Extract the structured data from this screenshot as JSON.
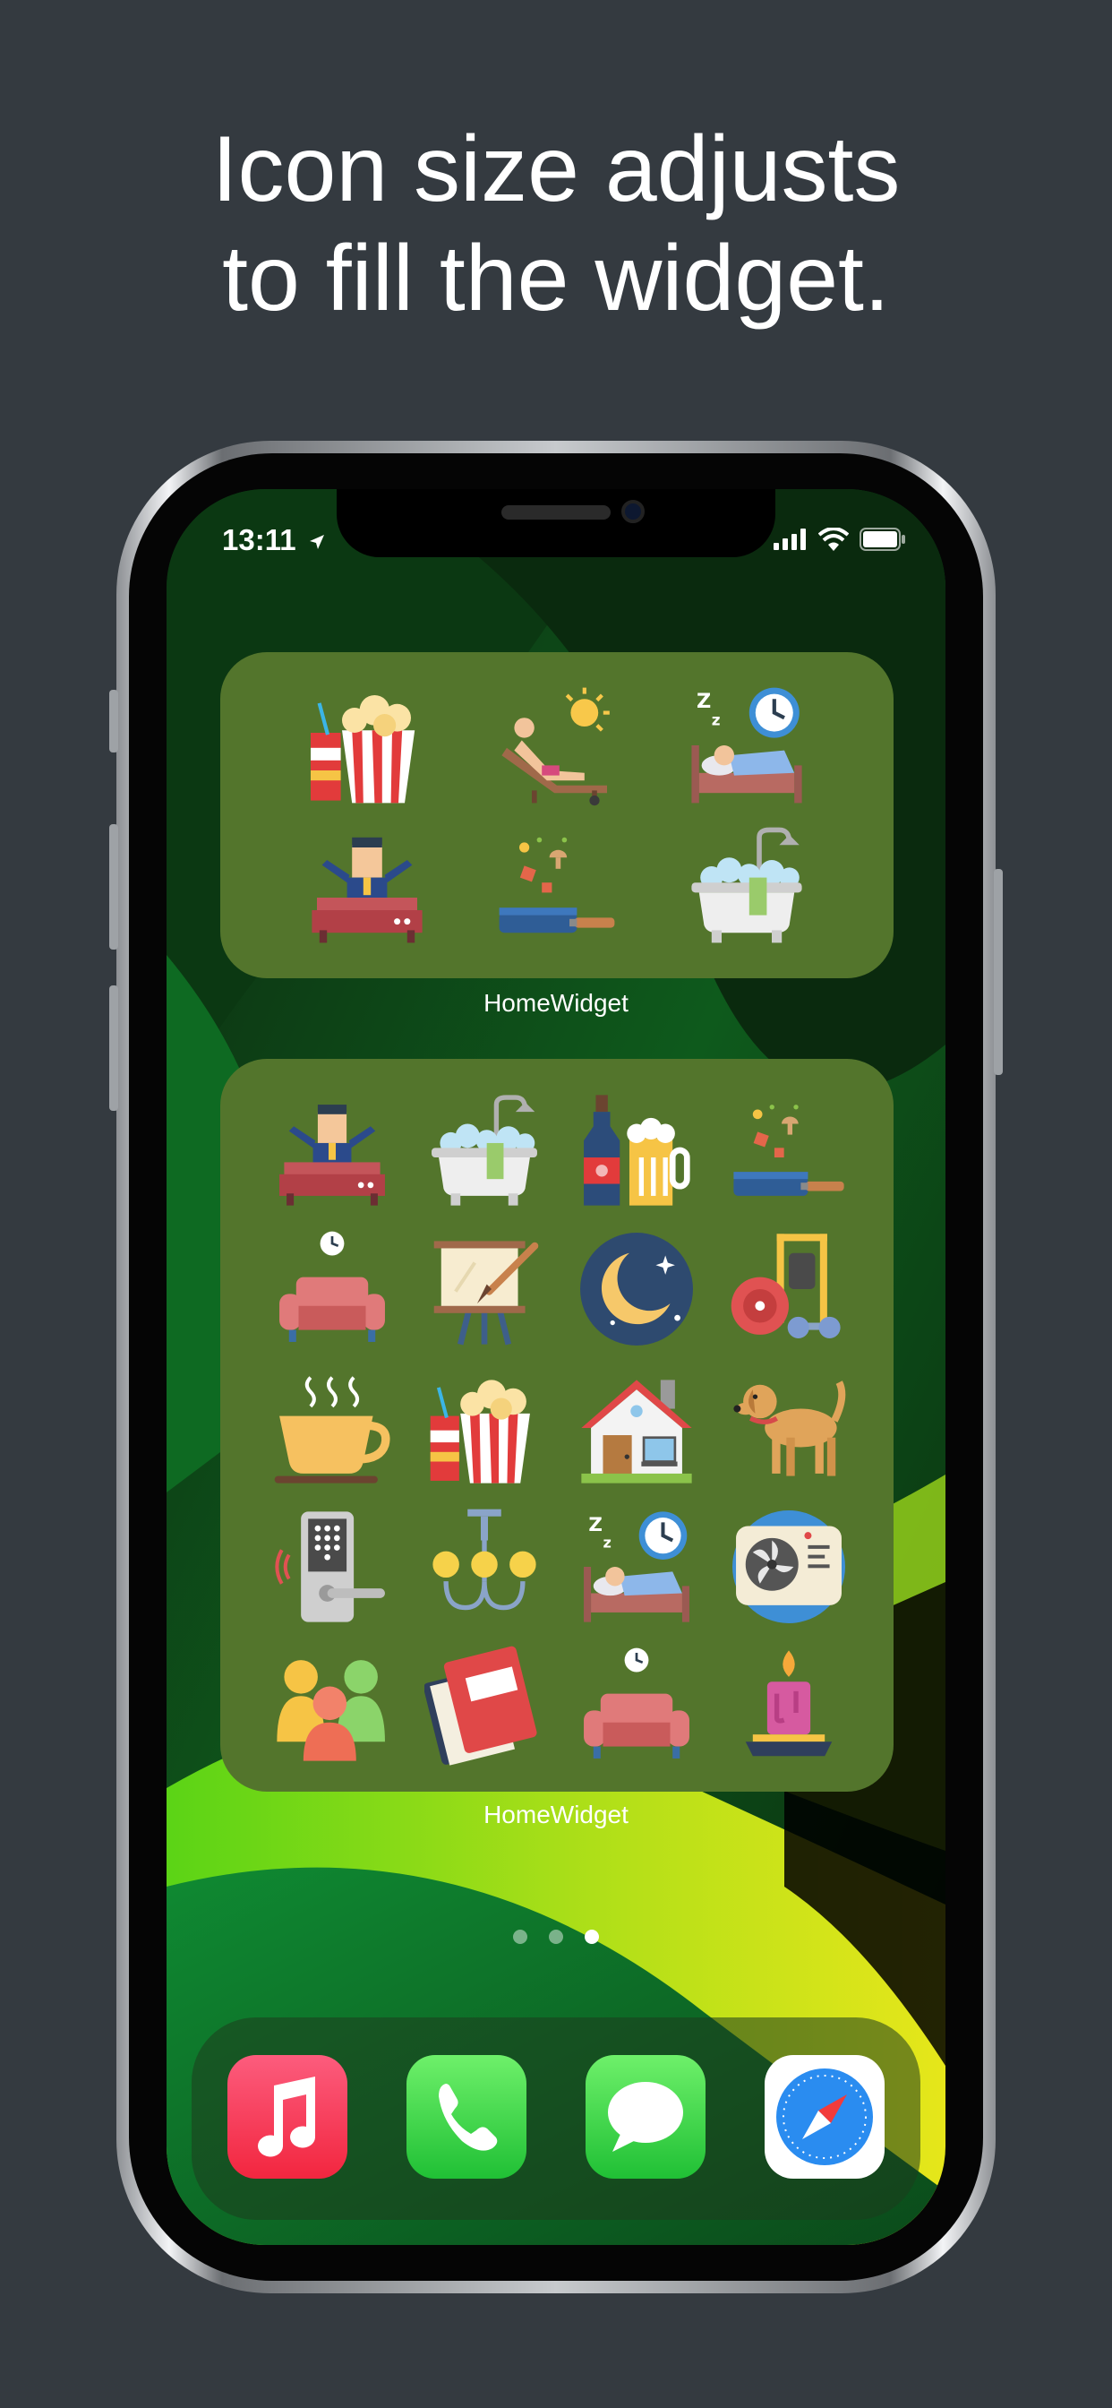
{
  "headline": {
    "line1": "Icon size adjusts",
    "line2": "to fill the widget."
  },
  "status_bar": {
    "time": "13:11",
    "icons": [
      "location-arrow-icon",
      "cellular-signal-icon",
      "wifi-icon",
      "battery-icon"
    ]
  },
  "widget_small": {
    "label": "HomeWidget",
    "icons": [
      "movie-popcorn-icon",
      "sunbathing-icon",
      "sleep-bed-icon",
      "wake-up-bed-icon",
      "cooking-pan-icon",
      "bathtub-icon"
    ]
  },
  "widget_large": {
    "label": "HomeWidget",
    "icons": [
      "wake-up-bed-icon",
      "bathtub-icon",
      "wine-beer-icon",
      "cooking-pan-icon",
      "sofa-timer-icon",
      "painting-easel-icon",
      "night-moon-icon",
      "gym-weights-icon",
      "coffee-cup-icon",
      "movie-popcorn-icon",
      "house-icon",
      "dog-icon",
      "smart-lock-icon",
      "chandelier-icon",
      "sleep-bed-icon",
      "air-conditioner-fan-icon",
      "family-icon",
      "books-icon",
      "sofa-timer-icon",
      "candle-icon"
    ]
  },
  "page_indicator": {
    "count": 3,
    "active": 3
  },
  "dock": {
    "apps": [
      "music-app-icon",
      "phone-app-icon",
      "messages-app-icon",
      "safari-app-icon"
    ]
  },
  "colors": {
    "background": "#343a40",
    "widget": "#53752c",
    "headline": "#ffffff"
  }
}
